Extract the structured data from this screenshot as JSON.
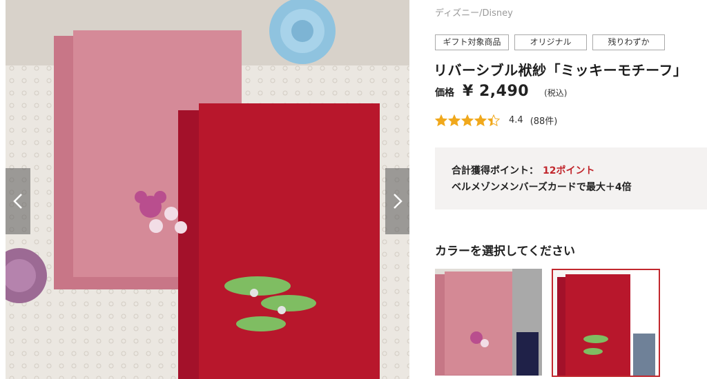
{
  "product": {
    "brand": "ディズニー/Disney",
    "tags": [
      "ギフト対象商品",
      "オリジナル",
      "残りわずか"
    ],
    "title": "リバーシブル袱紗「ミッキーモチーフ」",
    "price_label": "価格",
    "price": "¥ 2,490",
    "tax_note": "(税込)",
    "rating": "4.4",
    "rating_count": "(88件)",
    "rating_stars": 4.4
  },
  "points": {
    "label": "合計獲得ポイント：",
    "value": "12ポイント",
    "card_note": "ベルメゾンメンバーズカードで最大＋4倍"
  },
  "color_selector": {
    "heading": "カラーを選択してください",
    "options": [
      {
        "name": "pink",
        "main": "#d48995",
        "inner": "#1f2148"
      },
      {
        "name": "red",
        "main": "#b8172c",
        "inner": "#6f8198"
      }
    ],
    "selected": 1
  },
  "gallery": {
    "icons": {
      "prev": "chevron-left-icon",
      "next": "chevron-right-icon"
    }
  },
  "colors": {
    "accent": "#c1272d",
    "star": "#f0a81c",
    "points_bg": "#f4f2f1"
  }
}
